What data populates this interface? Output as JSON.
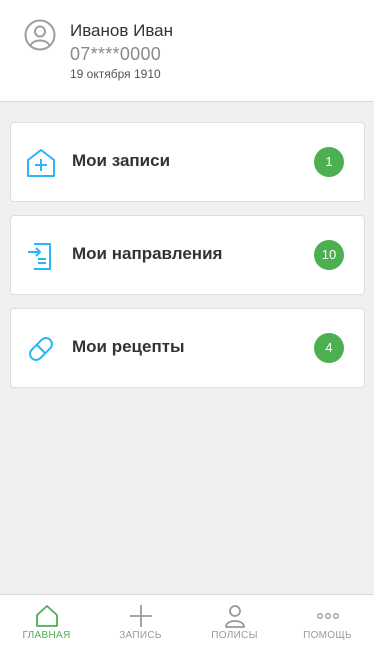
{
  "user": {
    "name": "Иванов Иван",
    "phone": "07****0000",
    "birth_date": "19 октября 1910"
  },
  "menu": [
    {
      "label": "Мои записи",
      "count": "1",
      "icon": "hospital-plus-icon"
    },
    {
      "label": "Мои направления",
      "count": "10",
      "icon": "document-arrow-icon"
    },
    {
      "label": "Мои рецепты",
      "count": "4",
      "icon": "pill-icon"
    }
  ],
  "bottom_nav": [
    {
      "label": "ГЛАВНАЯ",
      "icon": "home-icon",
      "active": true
    },
    {
      "label": "ЗАПИСЬ",
      "icon": "plus-icon",
      "active": false
    },
    {
      "label": "ПОЛИСЫ",
      "icon": "person-icon",
      "active": false
    },
    {
      "label": "ПОМОЩЬ",
      "icon": "dots-icon",
      "active": false
    }
  ],
  "colors": {
    "accent_green": "#4caf50",
    "icon_blue": "#29b6f6",
    "background": "#f0f0f0"
  }
}
